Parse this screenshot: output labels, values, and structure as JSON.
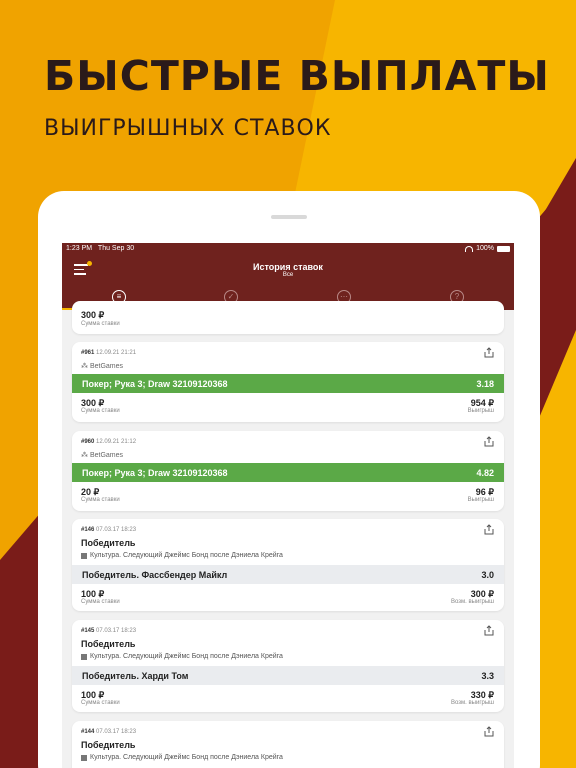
{
  "promo": {
    "headline": "БЫСТРЫЕ ВЫПЛАТЫ",
    "subline": "ВЫИГРЫШНЫХ СТАВОК"
  },
  "colors": {
    "yellow": "#f7b500",
    "maroon": "#6f221e",
    "green": "#5ba947"
  },
  "status_bar": {
    "time": "1:23 PM",
    "date": "Thu Sep 30",
    "battery": "100%"
  },
  "header": {
    "title": "История ставок",
    "subtitle": "Все",
    "menu_icon": "hamburger-menu-icon",
    "tabs": [
      {
        "icon": "list-icon",
        "glyph": "≡",
        "active": true
      },
      {
        "icon": "check-icon",
        "glyph": "✓",
        "active": false
      },
      {
        "icon": "pending-icon",
        "glyph": "⋯",
        "active": false
      },
      {
        "icon": "question-icon",
        "glyph": "?",
        "active": false
      }
    ]
  },
  "bets": [
    {
      "amount": "300 ₽",
      "amount_label": "Сумма ставки"
    },
    {
      "number": "#961",
      "datetime": "12.09.21 21:21",
      "provider": "BetGames",
      "selection": "Покер; Рука 3; Draw 32109120368",
      "odds": "3.18",
      "amount": "300 ₽",
      "amount_label": "Сумма ставки",
      "payout": "954 ₽",
      "payout_label": "Выигрыш"
    },
    {
      "number": "#960",
      "datetime": "12.09.21 21:12",
      "provider": "BetGames",
      "selection": "Покер; Рука 3; Draw 32109120368",
      "odds": "4.82",
      "amount": "20 ₽",
      "amount_label": "Сумма ставки",
      "payout": "96 ₽",
      "payout_label": "Выигрыш"
    },
    {
      "number": "#146",
      "datetime": "07.03.17 18:23",
      "market": "Победитель",
      "event": "Культура. Следующий Джеймс Бонд после Дэниела Крейга",
      "selection": "Победитель. Фассбендер Майкл",
      "odds": "3.0",
      "amount": "100 ₽",
      "amount_label": "Сумма ставки",
      "payout": "300 ₽",
      "payout_label": "Возм. выигрыш"
    },
    {
      "number": "#145",
      "datetime": "07.03.17 18:23",
      "market": "Победитель",
      "event": "Культура. Следующий Джеймс Бонд после Дэниела Крейга",
      "selection": "Победитель. Харди Том",
      "odds": "3.3",
      "amount": "100 ₽",
      "amount_label": "Сумма ставки",
      "payout": "330 ₽",
      "payout_label": "Возм. выигрыш"
    },
    {
      "number": "#144",
      "datetime": "07.03.17 18:23",
      "market": "Победитель",
      "event": "Культура. Следующий Джеймс Бонд после Дэниела Крейга"
    }
  ]
}
